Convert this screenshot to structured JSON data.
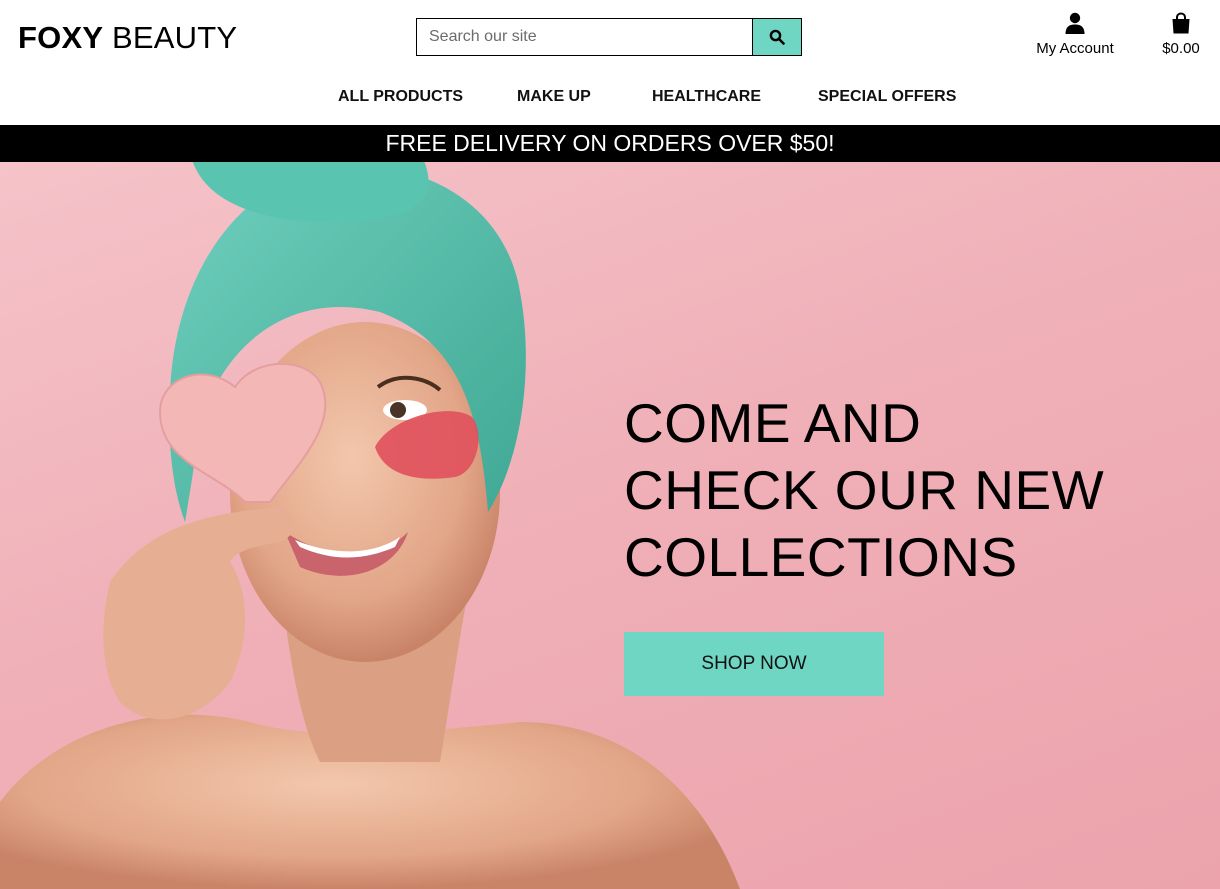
{
  "brand": {
    "name_bold": "FOXY",
    "name_rest": "BEAUTY"
  },
  "search": {
    "placeholder": "Search our site",
    "icon": "search-icon"
  },
  "account": {
    "label": "My Account",
    "icon": "user-icon"
  },
  "cart": {
    "total": "$0.00",
    "icon": "shopping-bag-icon"
  },
  "nav": {
    "items": [
      {
        "label": "ALL PRODUCTS"
      },
      {
        "label": "MAKE UP"
      },
      {
        "label": "HEALTHCARE"
      },
      {
        "label": "SPECIAL OFFERS"
      }
    ]
  },
  "banner": {
    "text": "FREE DELIVERY ON ORDERS OVER $50!"
  },
  "hero": {
    "headline_lines": [
      "COME AND",
      "CHECK OUR NEW",
      "COLLECTIONS"
    ],
    "cta_label": "SHOP NOW",
    "image": "woman-with-towel-and-heart-sponge"
  },
  "colors": {
    "accent": "#6ed6c3",
    "banner_bg": "#000000",
    "hero_bg": "#f0b0b8"
  }
}
